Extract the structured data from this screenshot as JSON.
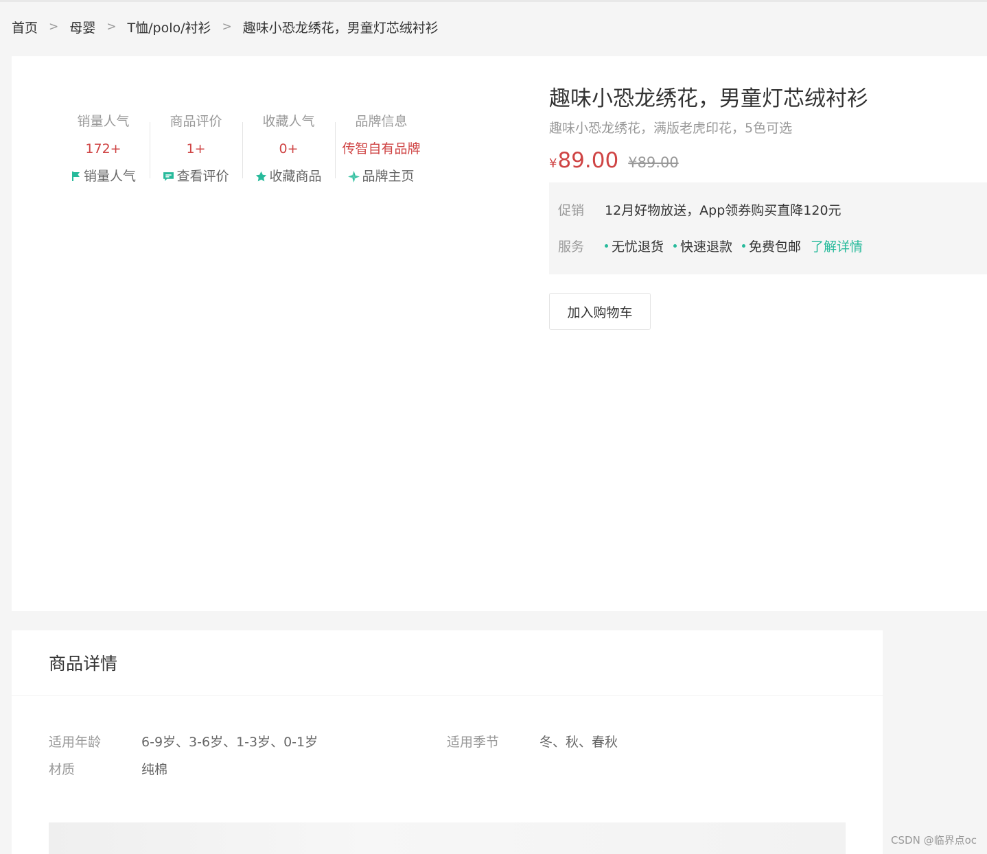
{
  "breadcrumb": {
    "items": [
      "首页",
      "母婴",
      "T恤/polo/衬衫",
      "趣味小恐龙绣花，男童灯芯绒衬衫"
    ],
    "separator": ">"
  },
  "stats": [
    {
      "label": "销量人气",
      "value": "172+",
      "link": "销量人气",
      "icon": "flag-icon"
    },
    {
      "label": "商品评价",
      "value": "1+",
      "link": "查看评价",
      "icon": "comment-icon"
    },
    {
      "label": "收藏人气",
      "value": "0+",
      "link": "收藏商品",
      "icon": "star-icon"
    },
    {
      "label": "品牌信息",
      "value": "传智自有品牌",
      "link": "品牌主页",
      "icon": "brand-icon"
    }
  ],
  "product": {
    "title": "趣味小恐龙绣花，男童灯芯绒衬衫",
    "desc": "趣味小恐龙绣花，满版老虎印花，5色可选",
    "currency": "¥",
    "price": "89.00",
    "old_price": "¥89.00"
  },
  "promo": {
    "label": "促销",
    "text": "12月好物放送，App领券购买直降120元"
  },
  "service": {
    "label": "服务",
    "items": [
      "无忧退货",
      "快速退款",
      "免费包邮"
    ],
    "more": "了解详情"
  },
  "cart_button": "加入购物车",
  "detail": {
    "title": "商品详情",
    "attrs": [
      {
        "name": "适用年龄",
        "value": "6-9岁、3-6岁、1-3岁、0-1岁"
      },
      {
        "name": "适用季节",
        "value": "冬、秋、春秋"
      },
      {
        "name": "材质",
        "value": "纯棉"
      }
    ]
  },
  "watermark": "CSDN @临界点oc",
  "colors": {
    "accent": "#27ba9b",
    "price": "#cf4444"
  }
}
